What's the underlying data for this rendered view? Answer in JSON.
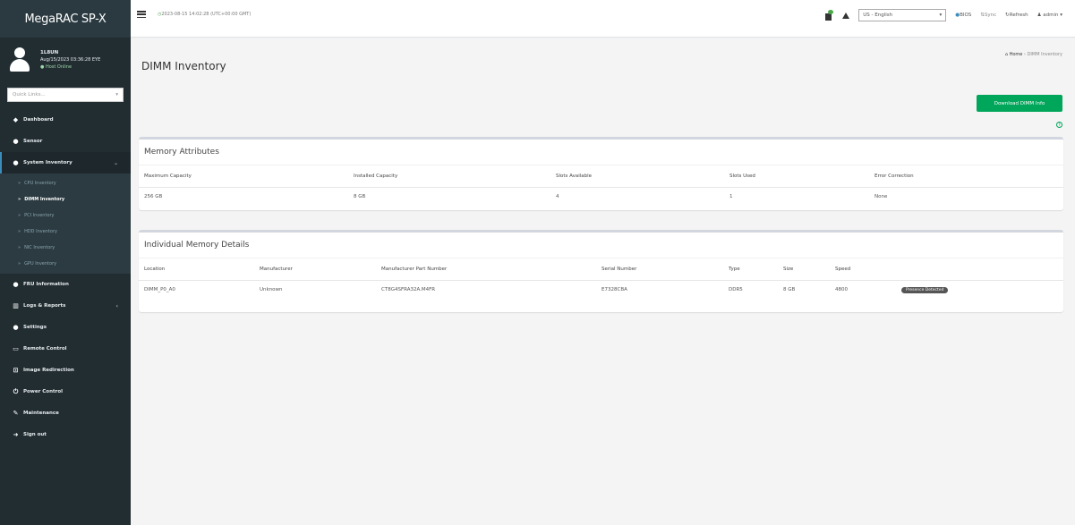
{
  "sidebar": {
    "brand": "MegaRAC SP-X",
    "user": {
      "name": "1L8UN",
      "login_time": "Aug/15/2023 03:36:28 EYE",
      "status": "Host Online"
    },
    "quick_links_placeholder": "Quick Links...",
    "items": [
      {
        "label": "Dashboard",
        "icon": "dashboard-icon",
        "glyph": "◆"
      },
      {
        "label": "Sensor",
        "icon": "sensor-icon",
        "glyph": "●"
      },
      {
        "label": "System Inventory",
        "icon": "inventory-icon",
        "glyph": "●"
      },
      {
        "label": "FRU Information",
        "icon": "fru-icon",
        "glyph": "●"
      },
      {
        "label": "Logs & Reports",
        "icon": "chart-icon",
        "glyph": "▥"
      },
      {
        "label": "Settings",
        "icon": "gear-icon",
        "glyph": "●"
      },
      {
        "label": "Remote Control",
        "icon": "monitor-icon",
        "glyph": "▭"
      },
      {
        "label": "Image Redirection",
        "icon": "image-icon",
        "glyph": "⊡"
      },
      {
        "label": "Power Control",
        "icon": "power-icon",
        "glyph": "⏻"
      },
      {
        "label": "Maintenance",
        "icon": "wrench-icon",
        "glyph": "✎"
      },
      {
        "label": "Sign out",
        "icon": "signout-icon",
        "glyph": "➜"
      }
    ],
    "system_inventory_sub": [
      {
        "label": "CPU Inventory"
      },
      {
        "label": "DIMM Inventory"
      },
      {
        "label": "PCI Inventory"
      },
      {
        "label": "HDD Inventory"
      },
      {
        "label": "NIC Inventory"
      },
      {
        "label": "GPU Inventory"
      }
    ]
  },
  "header": {
    "datetime": "2023-08-15 14:02:28 (UTC+00:00 GMT)",
    "language": "US - English",
    "bios_label": "BIOS",
    "sync_label": "Sync",
    "refresh_label": "Refresh",
    "user_label": "admin"
  },
  "main": {
    "title": "DIMM Inventory",
    "breadcrumb_home": "Home",
    "breadcrumb_current": "DIMM Inventory",
    "download_label": "Download DIMM Info",
    "memory_attributes": {
      "title": "Memory Attributes",
      "headers": [
        "Maximum Capacity",
        "Installed Capacity",
        "Slots Available",
        "Slots Used",
        "Error Correction"
      ],
      "values": [
        "256 GB",
        "8 GB",
        "4",
        "1",
        "None"
      ]
    },
    "memory_details": {
      "title": "Individual Memory Details",
      "headers": [
        "Location",
        "Manufacturer",
        "Manufacturer Part Number",
        "Serial Number",
        "Type",
        "Size",
        "Speed",
        ""
      ],
      "row": [
        "DIMM_P0_A0",
        "Unknown",
        "CT8G4SFRA32A.M4FR",
        "E7328CBA",
        "DDR5",
        "8 GB",
        "4800"
      ],
      "status_badge": "Presence Detected"
    }
  }
}
